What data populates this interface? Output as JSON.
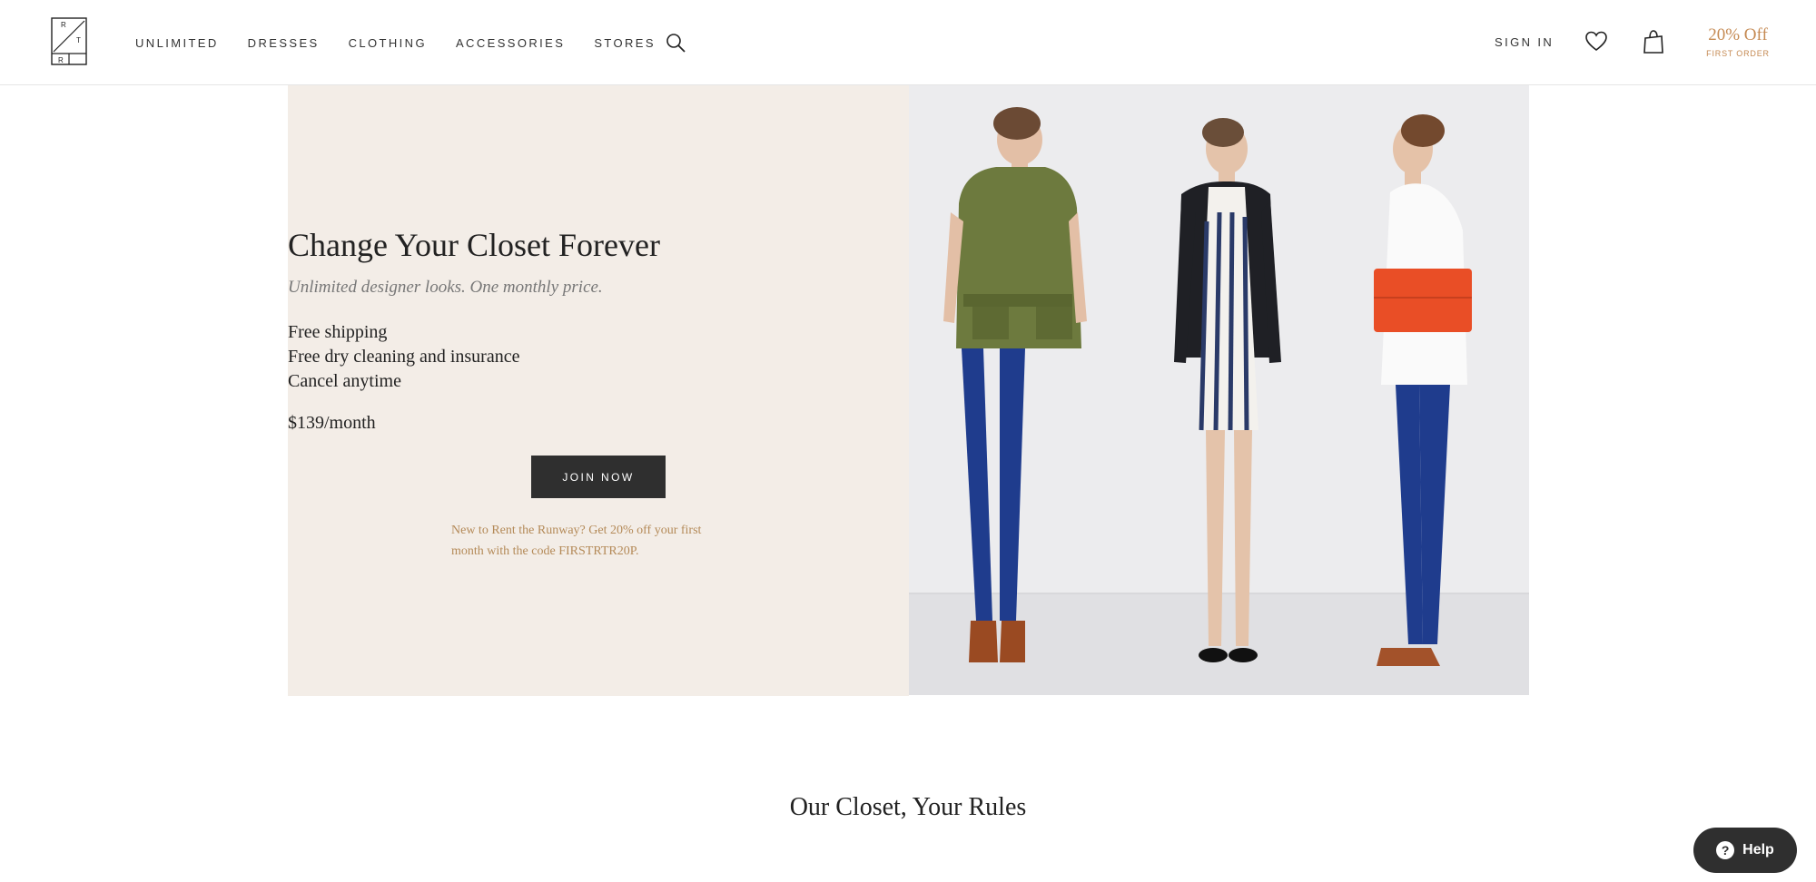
{
  "header": {
    "logo_letters": [
      "R",
      "T",
      "R"
    ],
    "nav": [
      "UNLIMITED",
      "DRESSES",
      "CLOTHING",
      "ACCESSORIES",
      "STORES"
    ],
    "sign_in": "SIGN IN",
    "promo_main": "20% Off",
    "promo_sub": "FIRST ORDER",
    "icons": [
      "search-icon",
      "heart-icon",
      "shopping-bag-icon"
    ]
  },
  "hero": {
    "title": "Change Your Closet Forever",
    "subtitle": "Unlimited designer looks. One monthly price.",
    "features": [
      "Free shipping",
      "Free dry cleaning and insurance",
      "Cancel anytime"
    ],
    "price": "$139/month",
    "cta": "JOIN NOW",
    "promo_line1": "New to Rent the Runway? Get 20% off your first",
    "promo_line2": "month with the code FIRSTRTR20P."
  },
  "section": {
    "title": "Our Closet, Your Rules"
  },
  "help": {
    "icon_glyph": "?",
    "label": "Help"
  },
  "colors": {
    "accent": "#c58a53",
    "hero_bg": "#f3ede7",
    "button_dark": "#2f2f2f"
  }
}
